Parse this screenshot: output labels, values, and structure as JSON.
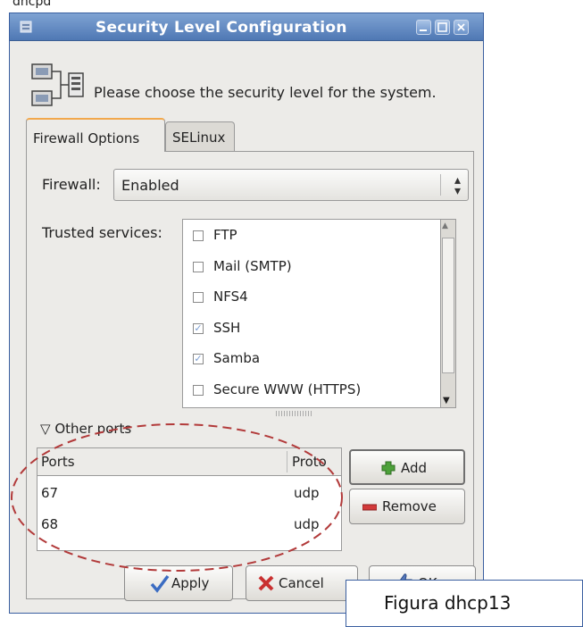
{
  "background_fragment": "dhcpd",
  "window": {
    "title": "Security Level Configuration",
    "minimize_icon": "minimize-icon",
    "maximize_icon": "maximize-icon",
    "close_icon": "close-icon"
  },
  "header": {
    "text": "Please choose the security level for the system."
  },
  "tabs": [
    {
      "label": "Firewall Options",
      "active": true
    },
    {
      "label": "SELinux",
      "active": false
    }
  ],
  "firewall": {
    "label": "Firewall:",
    "value": "Enabled"
  },
  "trusted": {
    "label": "Trusted services:",
    "items": [
      {
        "label": "FTP",
        "checked": false
      },
      {
        "label": "Mail (SMTP)",
        "checked": false
      },
      {
        "label": "NFS4",
        "checked": false
      },
      {
        "label": "SSH",
        "checked": true
      },
      {
        "label": "Samba",
        "checked": true
      },
      {
        "label": "Secure WWW (HTTPS)",
        "checked": false
      }
    ]
  },
  "other_ports": {
    "label": "Other ports",
    "columns": [
      "Ports",
      "Proto"
    ],
    "rows": [
      {
        "port": "67",
        "proto": "udp"
      },
      {
        "port": "68",
        "proto": "udp"
      }
    ],
    "add_label": "Add",
    "remove_label": "Remove"
  },
  "buttons": {
    "apply": "Apply",
    "cancel": "Cancel",
    "ok": "OK"
  },
  "caption": "Figura dhcp13",
  "colors": {
    "titlebar": "#5b82bb",
    "annotation": "#b23a3a",
    "checkmark": "#7a9cd1"
  }
}
